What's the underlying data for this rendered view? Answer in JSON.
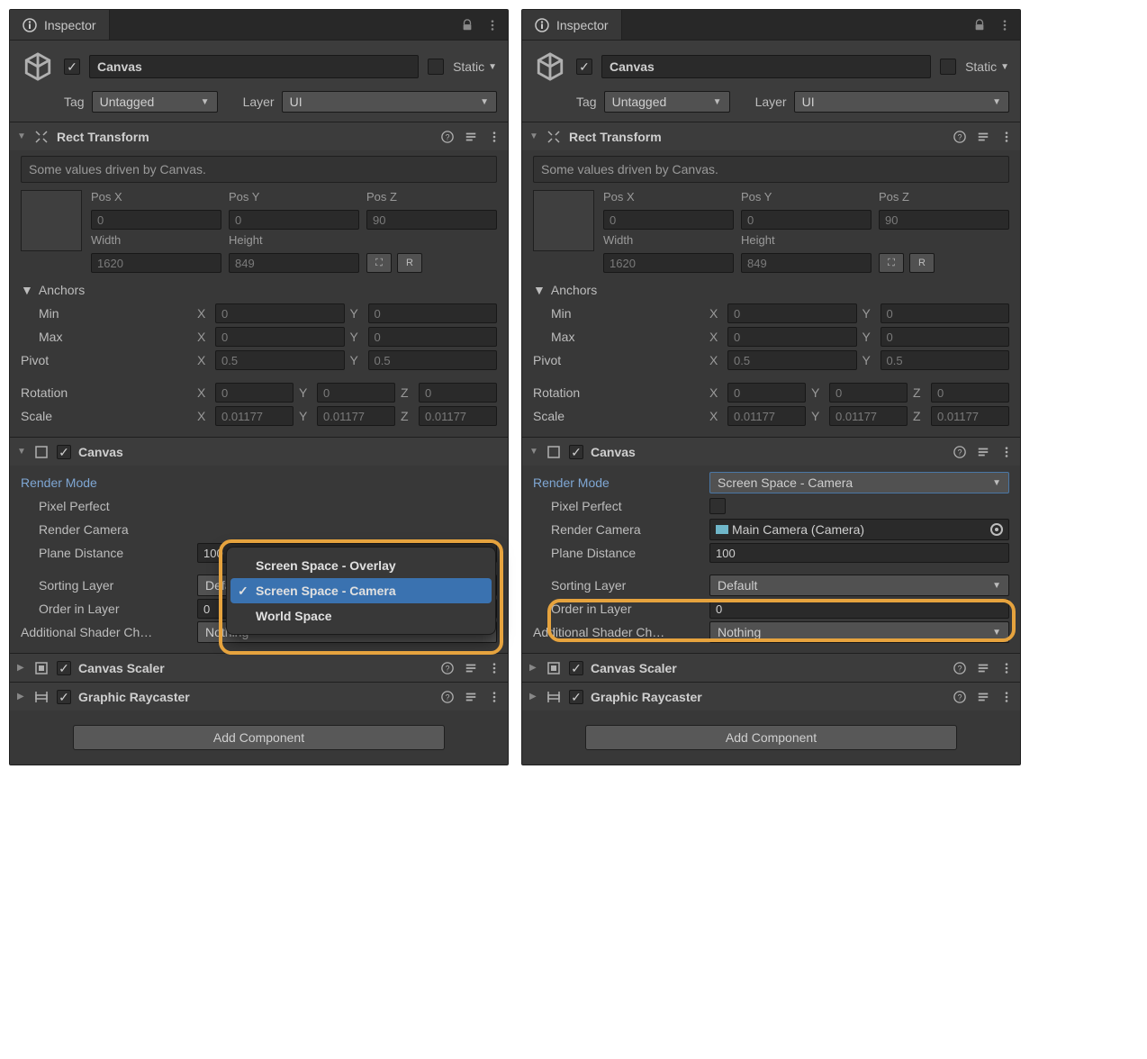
{
  "left": {
    "tab_title": "Inspector",
    "object_name": "Canvas",
    "static_label": "Static",
    "tag_label": "Tag",
    "tag_value": "Untagged",
    "layer_label": "Layer",
    "layer_value": "UI",
    "rect_transform": {
      "title": "Rect Transform",
      "info": "Some values driven by Canvas.",
      "pos_x_lbl": "Pos X",
      "pos_y_lbl": "Pos Y",
      "pos_z_lbl": "Pos Z",
      "pos_x": "0",
      "pos_y": "0",
      "pos_z": "90",
      "width_lbl": "Width",
      "height_lbl": "Height",
      "width": "1620",
      "height": "849",
      "r_btn": "R",
      "anchors_lbl": "Anchors",
      "min_lbl": "Min",
      "max_lbl": "Max",
      "min_x": "0",
      "min_y": "0",
      "max_x": "0",
      "max_y": "0",
      "pivot_lbl": "Pivot",
      "pivot_x": "0.5",
      "pivot_y": "0.5",
      "rotation_lbl": "Rotation",
      "rot_x": "0",
      "rot_y": "0",
      "rot_z": "0",
      "scale_lbl": "Scale",
      "scale_x": "0.01177",
      "scale_y": "0.01177",
      "scale_z": "0.01177"
    },
    "canvas": {
      "title": "Canvas",
      "render_mode_lbl": "Render Mode",
      "render_mode_options": [
        "Screen Space - Overlay",
        "Screen Space - Camera",
        "World Space"
      ],
      "render_mode_selected": "Screen Space - Camera",
      "pixel_perfect_lbl": "Pixel Perfect",
      "render_camera_lbl": "Render Camera",
      "plane_distance_lbl": "Plane Distance",
      "plane_distance": "100",
      "sorting_layer_lbl": "Sorting Layer",
      "sorting_layer": "Default",
      "order_lbl": "Order in Layer",
      "order": "0",
      "shader_lbl": "Additional Shader Ch…",
      "shader": "Nothing"
    },
    "canvas_scaler": "Canvas Scaler",
    "graphic_raycaster": "Graphic Raycaster",
    "add_component": "Add Component"
  },
  "right": {
    "tab_title": "Inspector",
    "object_name": "Canvas",
    "static_label": "Static",
    "tag_label": "Tag",
    "tag_value": "Untagged",
    "layer_label": "Layer",
    "layer_value": "UI",
    "rect_transform": {
      "title": "Rect Transform",
      "info": "Some values driven by Canvas.",
      "pos_x_lbl": "Pos X",
      "pos_y_lbl": "Pos Y",
      "pos_z_lbl": "Pos Z",
      "pos_x": "0",
      "pos_y": "0",
      "pos_z": "90",
      "width_lbl": "Width",
      "height_lbl": "Height",
      "width": "1620",
      "height": "849",
      "r_btn": "R",
      "anchors_lbl": "Anchors",
      "min_lbl": "Min",
      "max_lbl": "Max",
      "min_x": "0",
      "min_y": "0",
      "max_x": "0",
      "max_y": "0",
      "pivot_lbl": "Pivot",
      "pivot_x": "0.5",
      "pivot_y": "0.5",
      "rotation_lbl": "Rotation",
      "rot_x": "0",
      "rot_y": "0",
      "rot_z": "0",
      "scale_lbl": "Scale",
      "scale_x": "0.01177",
      "scale_y": "0.01177",
      "scale_z": "0.01177"
    },
    "canvas": {
      "title": "Canvas",
      "render_mode_lbl": "Render Mode",
      "render_mode_value": "Screen Space - Camera",
      "pixel_perfect_lbl": "Pixel Perfect",
      "render_camera_lbl": "Render Camera",
      "render_camera_value": "Main Camera (Camera)",
      "plane_distance_lbl": "Plane Distance",
      "plane_distance": "100",
      "sorting_layer_lbl": "Sorting Layer",
      "sorting_layer": "Default",
      "order_lbl": "Order in Layer",
      "order": "0",
      "shader_lbl": "Additional Shader Ch…",
      "shader": "Nothing"
    },
    "canvas_scaler": "Canvas Scaler",
    "graphic_raycaster": "Graphic Raycaster",
    "add_component": "Add Component"
  }
}
